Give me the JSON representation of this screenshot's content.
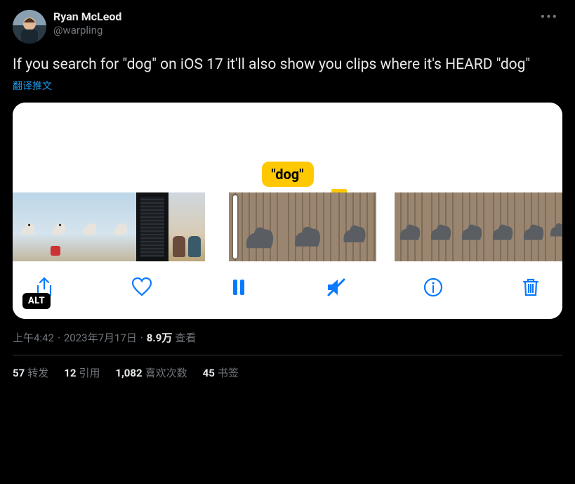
{
  "author": {
    "display_name": "Ryan McLeod",
    "handle": "@warpling"
  },
  "tweet_text": "If you search for \"dog\" on iOS 17 it'll also show you clips where it's HEARD \"dog\"",
  "translate_label": "翻译推文",
  "media": {
    "search_chip": "\"dog\"",
    "alt_badge": "ALT",
    "toolbar_icons": [
      "share",
      "heart",
      "pause",
      "mute",
      "info",
      "trash"
    ]
  },
  "meta": {
    "time": "上午4:42",
    "date": "2023年7月17日",
    "views_number": "8.9万",
    "views_label": "查看"
  },
  "stats": {
    "retweets": {
      "count": "57",
      "label": "转发"
    },
    "quotes": {
      "count": "12",
      "label": "引用"
    },
    "likes": {
      "count": "1,082",
      "label": "喜欢次数"
    },
    "bookmarks": {
      "count": "45",
      "label": "书签"
    }
  }
}
